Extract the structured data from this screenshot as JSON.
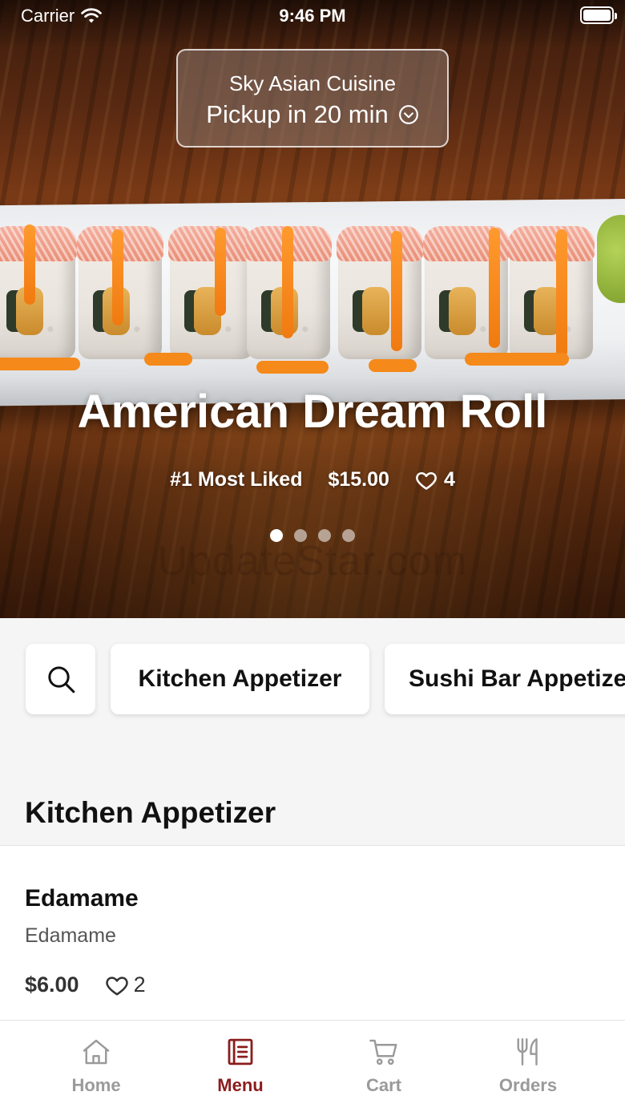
{
  "status_bar": {
    "carrier": "Carrier",
    "time": "9:46 PM"
  },
  "store": {
    "name": "Sky Asian Cuisine",
    "pickup": "Pickup in 20 min"
  },
  "featured": {
    "title": "American Dream Roll",
    "badge": "#1 Most Liked",
    "price": "$15.00",
    "likes": "4",
    "pages": 4,
    "active_page": 1
  },
  "watermark": "UpdateStar.com",
  "categories": {
    "search_icon": "search-icon",
    "items": [
      "Kitchen Appetizer",
      "Sushi Bar Appetize"
    ]
  },
  "section": {
    "title": "Kitchen Appetizer"
  },
  "menu_items": [
    {
      "name": "Edamame",
      "description": "Edamame",
      "price": "$6.00",
      "likes": "2"
    }
  ],
  "tab_bar": {
    "tabs": [
      {
        "label": "Home",
        "icon": "home-icon",
        "active": false
      },
      {
        "label": "Menu",
        "icon": "menu-book-icon",
        "active": true
      },
      {
        "label": "Cart",
        "icon": "cart-icon",
        "active": false
      },
      {
        "label": "Orders",
        "icon": "fork-knife-icon",
        "active": false
      }
    ]
  },
  "colors": {
    "accent": "#8b1c1c",
    "inactive": "#9a9a9a",
    "category_background": "#f5f5f5"
  }
}
